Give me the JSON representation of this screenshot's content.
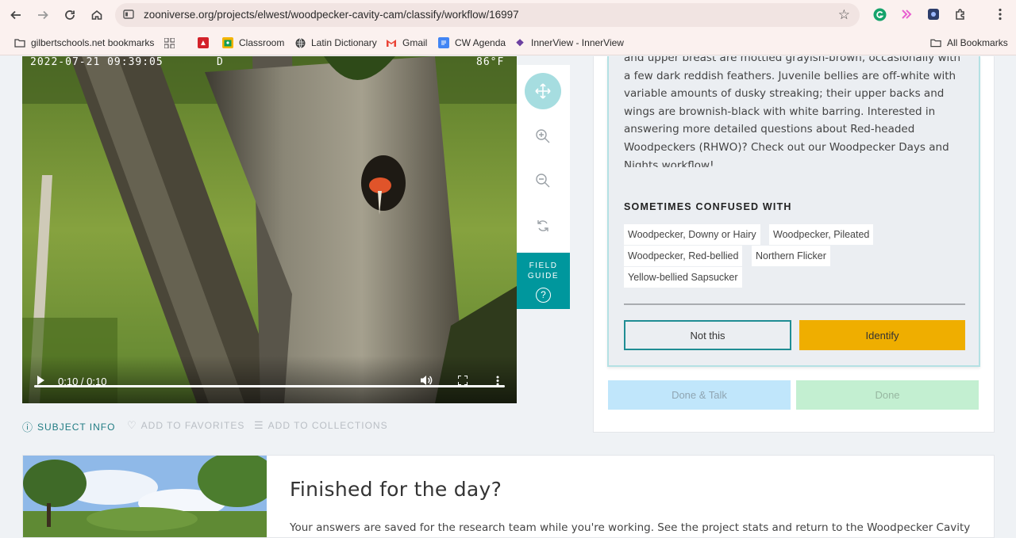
{
  "browser": {
    "url": "zooniverse.org/projects/elwest/woodpecker-cavity-cam/classify/workflow/16997",
    "bookmarks": [
      {
        "label": "gilbertschools.net bookmarks",
        "icon": "folder-icon"
      },
      {
        "label": "",
        "icon": "apps-grid-icon"
      },
      {
        "label": "",
        "icon": "red-app-icon"
      },
      {
        "label": "Classroom",
        "icon": "classroom-icon"
      },
      {
        "label": "Latin Dictionary",
        "icon": "globe-icon"
      },
      {
        "label": "Gmail",
        "icon": "gmail-icon"
      },
      {
        "label": "CW Agenda",
        "icon": "docs-icon"
      },
      {
        "label": "InnerView - InnerView",
        "icon": "innerview-icon"
      }
    ],
    "all_bookmarks": "All Bookmarks"
  },
  "video": {
    "timestamp_date": "2022-07-21 09:39:05",
    "timestamp_mode": "D",
    "timestamp_temp": "86°F",
    "time": "0:10 / 0:10",
    "progress": 1.0
  },
  "field_guide": {
    "label_line1": "FIELD",
    "label_line2": "GUIDE",
    "help": "?"
  },
  "subject_links": {
    "subject_info": "SUBJECT INFO",
    "favorites": "ADD TO FAVORITES",
    "collections": "ADD TO COLLECTIONS"
  },
  "species_card": {
    "description_partial_top": "and upper breast are mottled grayish-brown, occasionally with",
    "description": [
      "a few dark reddish feathers. Juvenile bellies are off-white with",
      "variable amounts of dusky streaking; their upper backs and",
      "wings are brownish-black with white barring. Interested in",
      "answering more detailed questions about Red-headed",
      "Woodpeckers (RHWO)? Check out our Woodpecker Days and",
      "Nights workflow!"
    ],
    "confused_title": "SOMETIMES CONFUSED WITH",
    "confused_with": [
      "Woodpecker, Downy or Hairy",
      "Woodpecker, Pileated",
      "Woodpecker, Red-bellied",
      "Northern Flicker",
      "Yellow-bellied Sapsucker"
    ],
    "not_this": "Not this",
    "identify": "Identify"
  },
  "actions": {
    "done_talk": "Done & Talk",
    "done": "Done"
  },
  "finished": {
    "title": "Finished for the day?",
    "text": "Your answers are saved for the research team while you're working. See the project stats and return to the Woodpecker Cavity"
  },
  "colors": {
    "teal": "#00979d",
    "identify_yellow": "#efae00",
    "done_talk_blue": "#c0e6fb",
    "done_green": "#c3efd1"
  }
}
